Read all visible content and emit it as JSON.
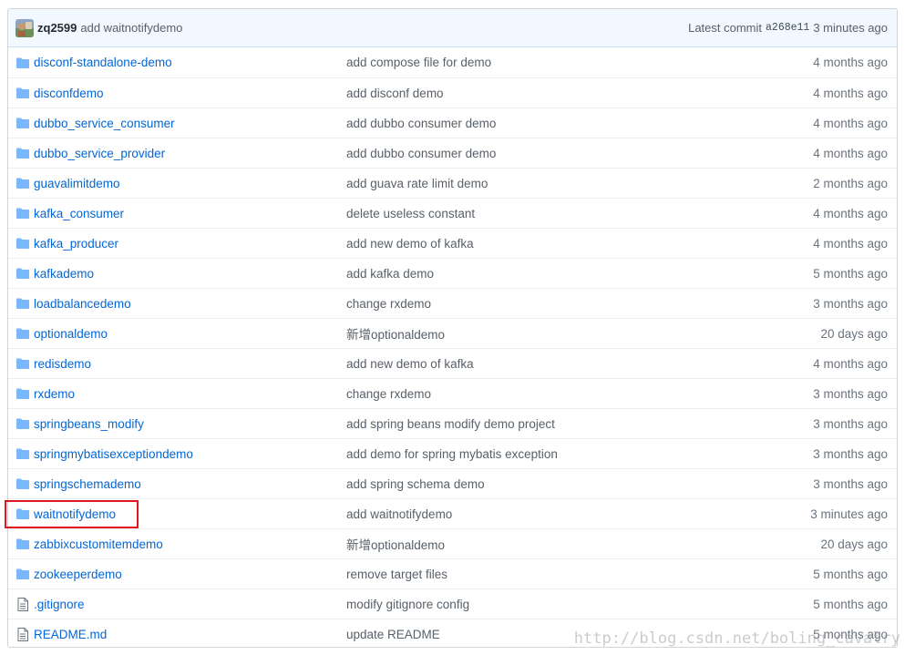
{
  "commit": {
    "author": "zq2599",
    "message": "add waitnotifydemo",
    "latest_label": "Latest commit",
    "sha": "a268e11",
    "time": "3 minutes ago"
  },
  "files": [
    {
      "type": "folder",
      "name": "disconf-standalone-demo",
      "message": "add compose file for demo",
      "age": "4 months ago"
    },
    {
      "type": "folder",
      "name": "disconfdemo",
      "message": "add disconf demo",
      "age": "4 months ago"
    },
    {
      "type": "folder",
      "name": "dubbo_service_consumer",
      "message": "add dubbo consumer demo",
      "age": "4 months ago"
    },
    {
      "type": "folder",
      "name": "dubbo_service_provider",
      "message": "add dubbo consumer demo",
      "age": "4 months ago"
    },
    {
      "type": "folder",
      "name": "guavalimitdemo",
      "message": "add guava rate limit demo",
      "age": "2 months ago"
    },
    {
      "type": "folder",
      "name": "kafka_consumer",
      "message": "delete useless constant",
      "age": "4 months ago"
    },
    {
      "type": "folder",
      "name": "kafka_producer",
      "message": "add new demo of kafka",
      "age": "4 months ago"
    },
    {
      "type": "folder",
      "name": "kafkademo",
      "message": "add kafka demo",
      "age": "5 months ago"
    },
    {
      "type": "folder",
      "name": "loadbalancedemo",
      "message": "change rxdemo",
      "age": "3 months ago"
    },
    {
      "type": "folder",
      "name": "optionaldemo",
      "message": "新增optionaldemo",
      "age": "20 days ago"
    },
    {
      "type": "folder",
      "name": "redisdemo",
      "message": "add new demo of kafka",
      "age": "4 months ago"
    },
    {
      "type": "folder",
      "name": "rxdemo",
      "message": "change rxdemo",
      "age": "3 months ago"
    },
    {
      "type": "folder",
      "name": "springbeans_modify",
      "message": "add spring beans modify demo project",
      "age": "3 months ago"
    },
    {
      "type": "folder",
      "name": "springmybatisexceptiondemo",
      "message": "add demo for spring mybatis exception",
      "age": "3 months ago"
    },
    {
      "type": "folder",
      "name": "springschemademo",
      "message": "add spring schema demo",
      "age": "3 months ago"
    },
    {
      "type": "folder",
      "name": "waitnotifydemo",
      "message": "add waitnotifydemo",
      "age": "3 minutes ago"
    },
    {
      "type": "folder",
      "name": "zabbixcustomitemdemo",
      "message": "新增optionaldemo",
      "age": "20 days ago"
    },
    {
      "type": "folder",
      "name": "zookeeperdemo",
      "message": "remove target files",
      "age": "5 months ago"
    },
    {
      "type": "file",
      "name": ".gitignore",
      "message": "modify gitignore config",
      "age": "5 months ago"
    },
    {
      "type": "file",
      "name": "README.md",
      "message": "update README",
      "age": "5 months ago"
    }
  ],
  "highlighted_item": "waitnotifydemo",
  "watermark": "http://blog.csdn.net/boling_cavalry",
  "colors": {
    "link": "#0366d6",
    "highlight_border": "#e0171e",
    "folder_icon": "#79b8ff"
  }
}
